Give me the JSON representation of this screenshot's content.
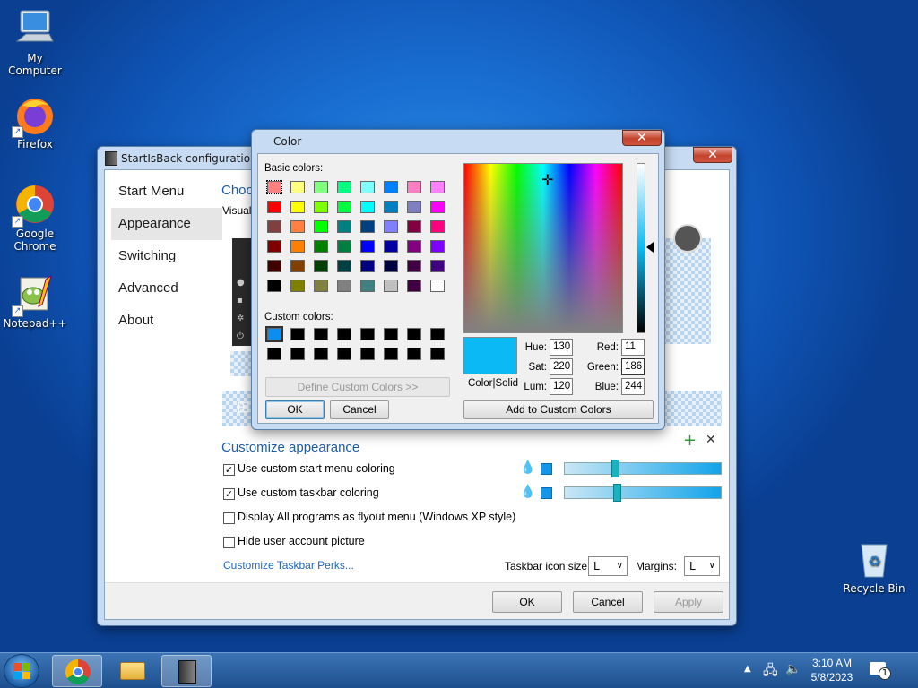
{
  "desktop": {
    "icons": [
      {
        "label": "My Computer"
      },
      {
        "label": "Firefox"
      },
      {
        "label": "Google Chrome"
      },
      {
        "label": "Notepad++"
      },
      {
        "label": "Recycle Bin"
      }
    ]
  },
  "config_window": {
    "title": "StartIsBack configuration",
    "nav": [
      "Start Menu",
      "Appearance",
      "Switching",
      "Advanced",
      "About"
    ],
    "selected_nav": "Appearance",
    "partial_heading": "Choos",
    "partial_subtext": "Visual s",
    "section_title": "Customize appearance",
    "options": [
      {
        "label": "Use custom start menu coloring",
        "checked": true,
        "slider_fraction": 0.31
      },
      {
        "label": "Use custom taskbar coloring",
        "checked": true,
        "slider_fraction": 0.32
      },
      {
        "label": "Display All programs as flyout menu (Windows XP style)",
        "checked": false
      },
      {
        "label": "Hide user account picture",
        "checked": false
      }
    ],
    "perks_link": "Customize Taskbar Perks...",
    "icon_size_label": "Taskbar icon size:",
    "icon_size_value": "L",
    "margins_label": "Margins:",
    "margins_value": "L",
    "buttons": {
      "ok": "OK",
      "cancel": "Cancel",
      "apply": "Apply"
    }
  },
  "color_dialog": {
    "title": "Color",
    "basic_colors_label": "Basic colors:",
    "basic_colors": [
      [
        "#ff8080",
        "#ffff80",
        "#80ff80",
        "#00ff80",
        "#80ffff",
        "#0080ff",
        "#ff80c0",
        "#ff80ff"
      ],
      [
        "#ff0000",
        "#ffff00",
        "#80ff00",
        "#00ff40",
        "#00ffff",
        "#0080c0",
        "#8080c0",
        "#ff00ff"
      ],
      [
        "#804040",
        "#ff8040",
        "#00ff00",
        "#008080",
        "#004080",
        "#8080ff",
        "#800040",
        "#ff0080"
      ],
      [
        "#800000",
        "#ff8000",
        "#008000",
        "#008040",
        "#0000ff",
        "#0000a0",
        "#800080",
        "#8000ff"
      ],
      [
        "#400000",
        "#804000",
        "#004000",
        "#004040",
        "#000080",
        "#000040",
        "#400040",
        "#400080"
      ],
      [
        "#000000",
        "#808000",
        "#808040",
        "#808080",
        "#408080",
        "#c0c0c0",
        "#400040",
        "#ffffff"
      ]
    ],
    "custom_colors_label": "Custom colors:",
    "custom_colors": [
      "#0b8ef0",
      "#000000",
      "#000000",
      "#000000",
      "#000000",
      "#000000",
      "#000000",
      "#000000",
      "#000000",
      "#000000",
      "#000000",
      "#000000",
      "#000000",
      "#000000",
      "#000000",
      "#000000"
    ],
    "define_custom": "Define Custom Colors >>",
    "ok": "OK",
    "cancel": "Cancel",
    "color_solid_label": "Color|Solid",
    "preview_color": "#0bbaf4",
    "hue_label": "Hue:",
    "hue": "130",
    "sat_label": "Sat:",
    "sat": "220",
    "lum_label": "Lum:",
    "lum": "120",
    "red_label": "Red:",
    "red": "11",
    "green_label": "Green:",
    "green": "186",
    "blue_label": "Blue:",
    "blue": "244",
    "add_custom": "Add to Custom Colors"
  },
  "tray": {
    "time": "3:10 AM",
    "date": "5/8/2023",
    "notification_count": "1"
  }
}
